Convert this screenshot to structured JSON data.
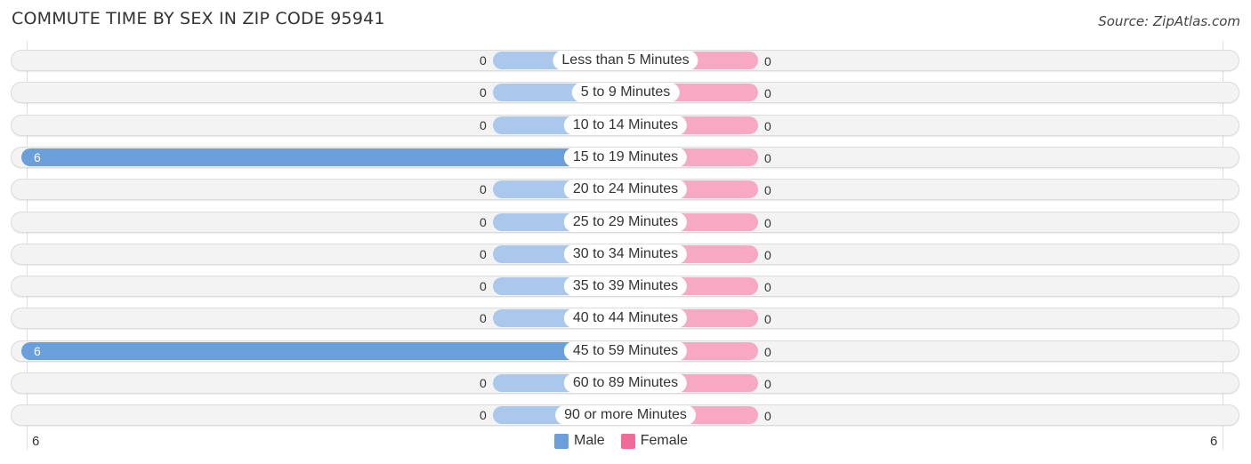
{
  "title": "COMMUTE TIME BY SEX IN ZIP CODE 95941",
  "source": "Source: ZipAtlas.com",
  "colors": {
    "male": "#6a9fdb",
    "male_zero": "#aac8ec",
    "female": "#f06b9a",
    "female_zero": "#f7a8c2"
  },
  "chart_data": {
    "type": "bar",
    "orientation": "horizontal-diverging",
    "title": "COMMUTE TIME BY SEX IN ZIP CODE 95941",
    "categories": [
      "Less than 5 Minutes",
      "5 to 9 Minutes",
      "10 to 14 Minutes",
      "15 to 19 Minutes",
      "20 to 24 Minutes",
      "25 to 29 Minutes",
      "30 to 34 Minutes",
      "35 to 39 Minutes",
      "40 to 44 Minutes",
      "45 to 59 Minutes",
      "60 to 89 Minutes",
      "90 or more Minutes"
    ],
    "series": [
      {
        "name": "Male",
        "values": [
          0,
          0,
          0,
          6,
          0,
          0,
          0,
          0,
          0,
          6,
          0,
          0
        ]
      },
      {
        "name": "Female",
        "values": [
          0,
          0,
          0,
          0,
          0,
          0,
          0,
          0,
          0,
          0,
          0,
          0
        ]
      }
    ],
    "axis": {
      "left_label": "6",
      "right_label": "6",
      "range": [
        -6,
        6
      ]
    },
    "legend": {
      "position": "bottom-center",
      "entries": [
        "Male",
        "Female"
      ]
    }
  }
}
